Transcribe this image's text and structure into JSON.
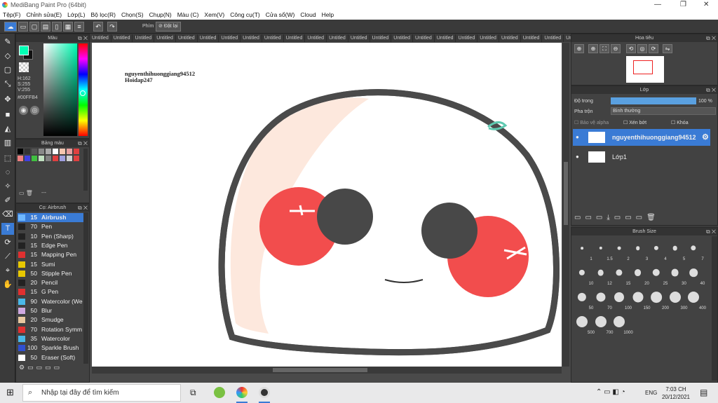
{
  "window": {
    "title": "MediBang Paint Pro (64bit)"
  },
  "menu": [
    "Tệp(F)",
    "Chỉnh sửa(E)",
    "Lớp(L)",
    "Bộ lọc(R)",
    "Chọn(S)",
    "Chụp(N)",
    "Màu (C)",
    "Xem(V)",
    "Công cụ(T)",
    "Cửa sổ(W)",
    "Cloud",
    "Help"
  ],
  "toolbar": {
    "shortcut_label": "Phím",
    "reset_label": "Đặt lại"
  },
  "tabs": [
    "Untitled",
    "Untitled",
    "Untitled",
    "Untitled",
    "Untitled",
    "Untitled",
    "Untitled",
    "Untitled",
    "Untitled",
    "Untitled",
    "Untitled",
    "Untitled",
    "Untitled",
    "Untitled",
    "Untitled",
    "Untitled",
    "Untitled",
    "Untitled",
    "Untitled",
    "Untitled",
    "Untitled",
    "Untitled",
    "Untitled"
  ],
  "color_panel": {
    "title": "Màu",
    "h": "H:162",
    "s": "S:255",
    "v": "V:255",
    "hex": "#00FFB4",
    "accent": "#00ffb4"
  },
  "palette_panel": {
    "title": "Bảng màu",
    "footer": "---"
  },
  "brush_panel": {
    "title": "Cọ: Airbrush",
    "brushes": [
      {
        "size": "15",
        "name": "Airbrush",
        "color": "#6fb8ff"
      },
      {
        "size": "70",
        "name": "Pen",
        "color": "#222"
      },
      {
        "size": "10",
        "name": "Pen (Sharp)",
        "color": "#222"
      },
      {
        "size": "15",
        "name": "Edge Pen",
        "color": "#222"
      },
      {
        "size": "15",
        "name": "Mapping Pen",
        "color": "#e03030"
      },
      {
        "size": "15",
        "name": "Sumi",
        "color": "#e8c800"
      },
      {
        "size": "50",
        "name": "Stipple Pen",
        "color": "#e8c800"
      },
      {
        "size": "20",
        "name": "Pencil",
        "color": "#222"
      },
      {
        "size": "15",
        "name": "G Pen",
        "color": "#e03030"
      },
      {
        "size": "90",
        "name": "Watercolor (We",
        "color": "#4ab8e8"
      },
      {
        "size": "50",
        "name": "Blur",
        "color": "#cfa8e0"
      },
      {
        "size": "20",
        "name": "Smudge",
        "color": "#e8c8a0"
      },
      {
        "size": "70",
        "name": "Rotation Symm",
        "color": "#e03030"
      },
      {
        "size": "35",
        "name": "Watercolor",
        "color": "#4ab8e8"
      },
      {
        "size": "100",
        "name": "Sparkle Brush",
        "color": "#3050d0"
      },
      {
        "size": "50",
        "name": "Eraser (Soft)",
        "color": "#ffffff"
      }
    ]
  },
  "canvas": {
    "watermark_line1": "nguyenthihuonggiang94512",
    "watermark_line2": "Hoidap247"
  },
  "navigator": {
    "title": "Hoa tiêu"
  },
  "layer_panel": {
    "title": "Lớp",
    "opacity_label": "Độ trong",
    "opacity_value": "100 %",
    "opacity_fraction": 1.0,
    "blend_label": "Pha trộn",
    "blend_value": "Bình thường",
    "protect_alpha": "Bảo vệ alpha",
    "clipping": "Xén bớt",
    "lock": "Khóa",
    "layers": [
      "nguyenthihuonggiang94512",
      "Lớp1"
    ]
  },
  "brush_size_panel": {
    "title": "Brush Size",
    "sizes": [
      "1",
      "1.5",
      "2",
      "3",
      "4",
      "5",
      "7",
      "10",
      "12",
      "15",
      "20",
      "25",
      "30",
      "40",
      "50",
      "70",
      "100",
      "150",
      "200",
      "300",
      "400",
      "500",
      "700",
      "1000"
    ]
  },
  "taskbar": {
    "search_placeholder": "Nhập tại đây để tìm kiếm",
    "lang": "ENG",
    "time": "7:03 CH",
    "date": "20/12/2021"
  }
}
